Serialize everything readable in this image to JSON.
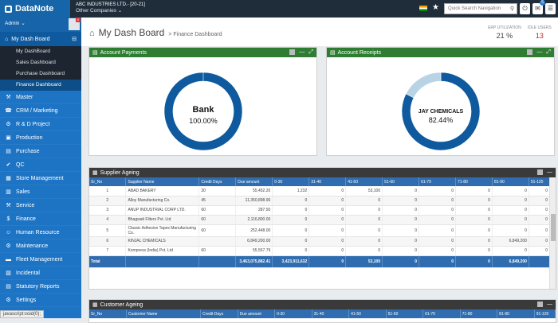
{
  "app": {
    "name": "DataNote",
    "company": "ABC INDUSTRIES LTD.- [20-21]",
    "company_switch": "Other Companies"
  },
  "top": {
    "search_placeholder": "Quick Search Navigation",
    "badge_count": "5"
  },
  "sidebar": {
    "user": "Admin",
    "avatar_badge": "0",
    "my_dashboard": "My Dash Board",
    "submenu": [
      "My DashBoard",
      "Sales Dashboard",
      "Purchase Dashboard",
      "Finance Dashboard"
    ],
    "items": [
      {
        "label": "Master",
        "icon": "master-icon",
        "glyph": "⚒"
      },
      {
        "label": "CRM / Marketing",
        "icon": "crm-icon",
        "glyph": "☎"
      },
      {
        "label": "R & D Project",
        "icon": "project-icon",
        "glyph": "⚙"
      },
      {
        "label": "Production",
        "icon": "factory-icon",
        "glyph": "▣"
      },
      {
        "label": "Purchase",
        "icon": "cart-icon",
        "glyph": "▤"
      },
      {
        "label": "QC",
        "icon": "qc-icon",
        "glyph": "✔"
      },
      {
        "label": "Store Management",
        "icon": "store-icon",
        "glyph": "▦"
      },
      {
        "label": "Sales",
        "icon": "sales-icon",
        "glyph": "▥"
      },
      {
        "label": "Service",
        "icon": "service-icon",
        "glyph": "⚒"
      },
      {
        "label": "Finance",
        "icon": "finance-icon",
        "glyph": "$"
      },
      {
        "label": "Human Resource",
        "icon": "hr-icon",
        "glyph": "☺"
      },
      {
        "label": "Maintenance",
        "icon": "maintenance-icon",
        "glyph": "⚙"
      },
      {
        "label": "Fleet Management",
        "icon": "fleet-icon",
        "glyph": "▬"
      },
      {
        "label": "Incidental",
        "icon": "incidental-icon",
        "glyph": "▧"
      },
      {
        "label": "Statutory Reports",
        "icon": "reports-icon",
        "glyph": "▤"
      },
      {
        "label": "Settings",
        "icon": "settings-icon",
        "glyph": "⚙"
      }
    ],
    "status_url": "javascript:void(0);"
  },
  "header": {
    "title": "My Dash Board",
    "breadcrumb": "> Finance Dashboard",
    "erp_label": "ERP UTILIZATION",
    "erp_value": "21 %",
    "idle_label": "IDLE USERS",
    "idle_value": "13"
  },
  "payments": {
    "title": "Account Payments",
    "center_label": "Bank",
    "center_value": "100.00%"
  },
  "receipts": {
    "title": "Account Receipts",
    "center_label": "JAY CHEMICALS",
    "center_value": "82.44%"
  },
  "ageing": {
    "title": "Supplier Ageing",
    "columns": [
      "Sr_No",
      "Supplier Name",
      "Credit Days",
      "Due amount",
      "0-30",
      "31-40",
      "41-50",
      "51-60",
      "61-70",
      "71-80",
      "81-90",
      "91-120"
    ],
    "rows": [
      [
        "1",
        "ABAD BAKERY",
        "30",
        "55,452.20",
        "1,232",
        "0",
        "53,100",
        "0",
        "0",
        "0",
        "0",
        "0"
      ],
      [
        "2",
        "Alloy Manufacturing Co.",
        "45",
        "11,350,898.96",
        "0",
        "0",
        "0",
        "0",
        "0",
        "0",
        "0",
        "0"
      ],
      [
        "3",
        "ANUP INDUSTRIAL CORP LTD.",
        "60",
        "287.50",
        "0",
        "0",
        "0",
        "0",
        "0",
        "0",
        "0",
        "0"
      ],
      [
        "4",
        "Bhagwati Filters Pvt. Ltd",
        "60",
        "2,116,800.00",
        "0",
        "0",
        "0",
        "0",
        "0",
        "0",
        "0",
        "0"
      ],
      [
        "5",
        "Classic Adhesive Tapes Manufacturing Co.",
        "60",
        "252,448.00",
        "0",
        "0",
        "0",
        "0",
        "0",
        "0",
        "0",
        "0"
      ],
      [
        "6",
        "KINJAL CHEMICALS",
        "",
        "6,849,200.00",
        "0",
        "0",
        "0",
        "0",
        "0",
        "0",
        "6,849,200",
        "0"
      ],
      [
        "7",
        "Kompress (India) Pvt. Ltd",
        "60",
        "55,557.79",
        "0",
        "0",
        "0",
        "0",
        "0",
        "0",
        "0",
        "0"
      ]
    ],
    "total": [
      "Total",
      "",
      "",
      "3,463,075,882.41",
      "3,423,911,632",
      "0",
      "53,100",
      "0",
      "0",
      "0",
      "6,849,200",
      ""
    ]
  },
  "customer": {
    "title": "Customer Ageing",
    "columns": [
      "Sr_No",
      "Customer Name",
      "Credit Days",
      "Due amount",
      "0-30",
      "31-40",
      "41-50",
      "51-60",
      "61-70",
      "71-80",
      "81-90",
      "91-120"
    ]
  },
  "chart_data": [
    {
      "type": "pie",
      "title": "Account Payments",
      "categories": [
        "Bank"
      ],
      "values": [
        100.0
      ]
    },
    {
      "type": "pie",
      "title": "Account Receipts",
      "categories": [
        "JAY CHEMICALS",
        "Other"
      ],
      "values": [
        82.44,
        17.56
      ]
    }
  ],
  "colors": {
    "brand": "#1d74c4",
    "header_green": "#2e7d32",
    "table_blue": "#2f6db0",
    "donut_dark": "#0f5a9e",
    "donut_light": "#b9d3e6"
  }
}
